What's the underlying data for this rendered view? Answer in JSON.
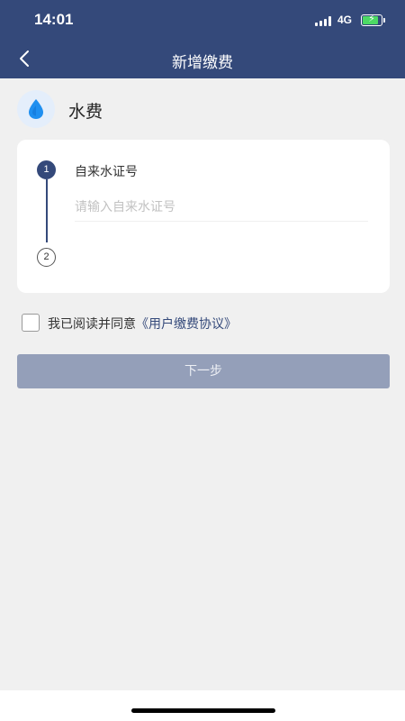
{
  "status_bar": {
    "time": "14:01",
    "network": "4G",
    "icons": [
      "signal-icon",
      "battery-charging-icon"
    ]
  },
  "nav": {
    "title": "新增缴费",
    "back_icon": "chevron-left-icon"
  },
  "service": {
    "icon": "water-drop-icon",
    "name": "水费"
  },
  "form": {
    "steps": [
      {
        "number": "1",
        "label": "自来水证号",
        "placeholder": "请输入自来水证号",
        "value": ""
      },
      {
        "number": "2"
      }
    ]
  },
  "agreement": {
    "checked": false,
    "text": "我已阅读并同意",
    "link": "《用户缴费协议》"
  },
  "next_button": {
    "label": "下一步"
  },
  "colors": {
    "primary": "#34497a",
    "background": "#f0f0f0",
    "button_disabled": "#949fb9",
    "battery": "#4cd964"
  }
}
